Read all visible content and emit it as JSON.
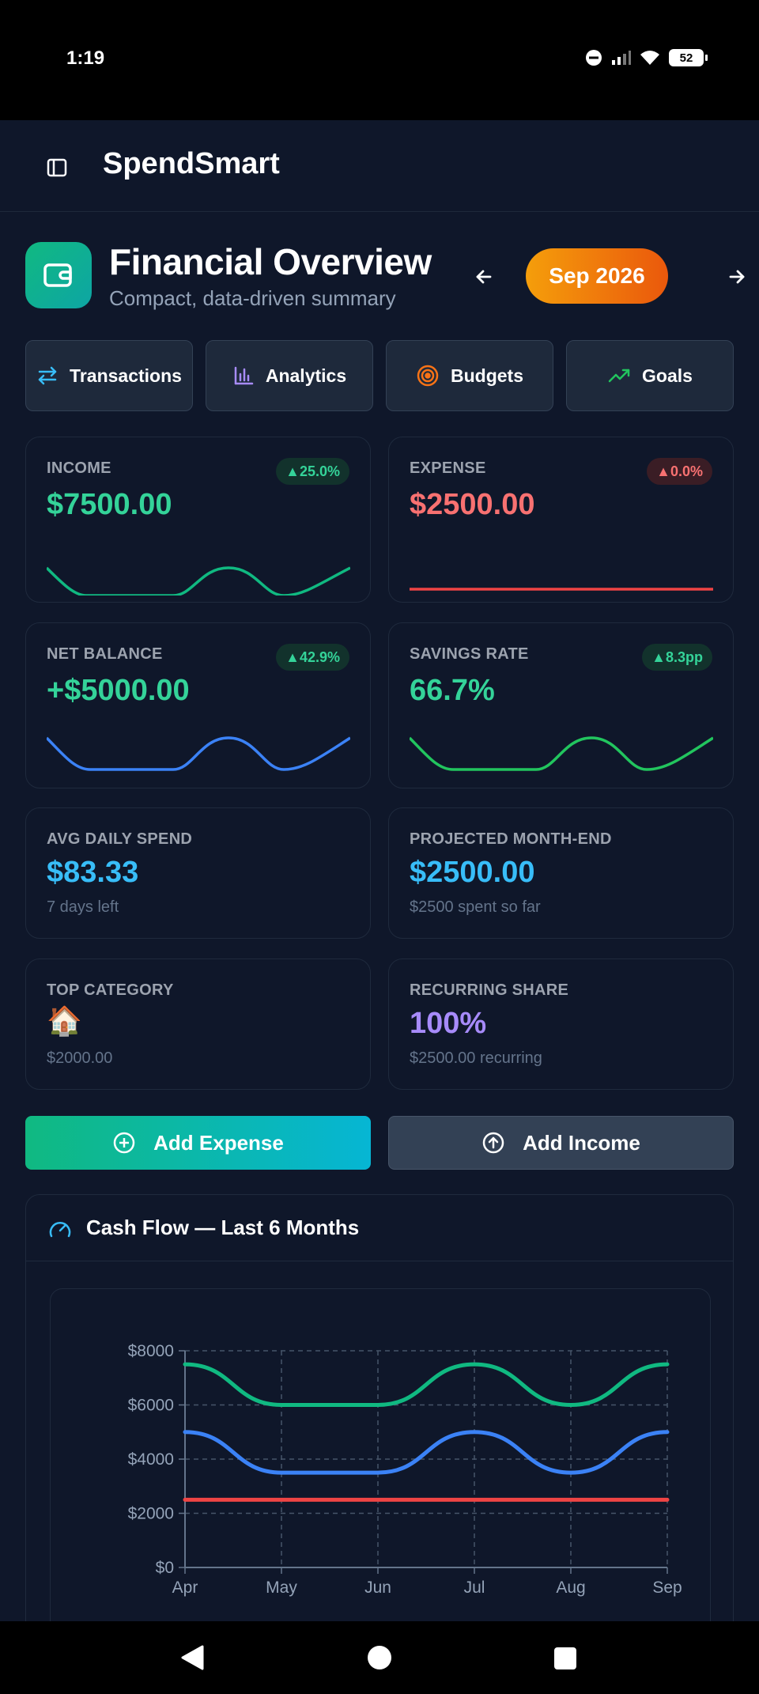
{
  "status": {
    "time": "1:19",
    "battery": "52"
  },
  "app": {
    "title": "SpendSmart"
  },
  "header": {
    "title": "Financial Overview",
    "subtitle": "Compact, data-driven summary",
    "month": "Sep 2026"
  },
  "nav": [
    {
      "label": "Transactions",
      "icon": "swap-arrows-icon"
    },
    {
      "label": "Analytics",
      "icon": "bar-chart-icon"
    },
    {
      "label": "Budgets",
      "icon": "target-icon"
    },
    {
      "label": "Goals",
      "icon": "trending-up-icon"
    }
  ],
  "cards": {
    "income": {
      "label": "INCOME",
      "value": "$7500.00",
      "badge": "▲25.0%"
    },
    "expense": {
      "label": "EXPENSE",
      "value": "$2500.00",
      "badge": "▲0.0%"
    },
    "net": {
      "label": "NET BALANCE",
      "value": "+$5000.00",
      "badge": "▲42.9%"
    },
    "savings": {
      "label": "SAVINGS RATE",
      "value": "66.7%",
      "badge": "▲8.3pp"
    },
    "avg": {
      "label": "AVG DAILY SPEND",
      "value": "$83.33",
      "sub": "7 days left"
    },
    "projected": {
      "label": "PROJECTED MONTH-END",
      "value": "$2500.00",
      "sub": "$2500 spent so far"
    },
    "topcat": {
      "label": "TOP CATEGORY",
      "emoji": "🏠",
      "sub": "$2000.00"
    },
    "recurring": {
      "label": "RECURRING SHARE",
      "value": "100%",
      "sub": "$2500.00 recurring"
    }
  },
  "actions": {
    "add_expense": "Add Expense",
    "add_income": "Add Income"
  },
  "cashflow": {
    "title": "Cash Flow — Last 6 Months"
  },
  "colors": {
    "green": "#10b981",
    "red": "#ef4444",
    "blue": "#3b82f6",
    "sky": "#38bdf8",
    "purple": "#a78bfa",
    "accent": "#f59e0b"
  },
  "chart_data": {
    "type": "line",
    "categories": [
      "Apr",
      "May",
      "Jun",
      "Jul",
      "Aug",
      "Sep"
    ],
    "series": [
      {
        "color": "#10b981",
        "values": [
          7500,
          6000,
          6000,
          7500,
          6000,
          7500
        ]
      },
      {
        "color": "#3b82f6",
        "values": [
          5000,
          3500,
          3500,
          5000,
          3500,
          5000
        ]
      },
      {
        "color": "#ef4444",
        "values": [
          2500,
          2500,
          2500,
          2500,
          2500,
          2500
        ]
      }
    ],
    "yticks": [
      "$0",
      "$2000",
      "$4000",
      "$6000",
      "$8000"
    ],
    "ylim": [
      0,
      8000
    ],
    "grid": true
  }
}
